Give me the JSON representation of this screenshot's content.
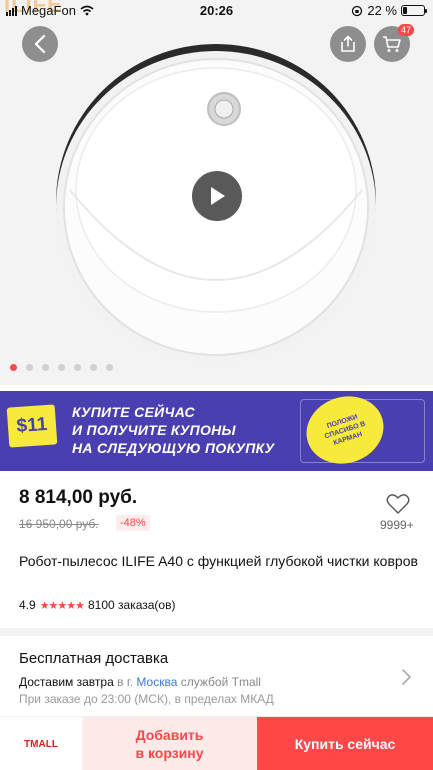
{
  "status_bar": {
    "brand_ghost": "ILIFE",
    "carrier": "MegaFon",
    "time": "20:26",
    "battery_text": "22 %",
    "battery_level": 0.22
  },
  "header": {
    "cart_badge": "47"
  },
  "gallery": {
    "dot_count": 7,
    "active_index": 0
  },
  "banner": {
    "coupon_value": "$11",
    "line1": "КУПИТЕ СЕЙЧАС",
    "line2": "И ПОЛУЧИТЕ КУПОНЫ",
    "line3": "НА СЛЕДУЮЩУЮ ПОКУПКУ",
    "sticker_text": "ПОЛОЖИ СПАСИБО В КАРМАН"
  },
  "product": {
    "price": "8 814,00 руб.",
    "old_price": "16 950,00 руб.",
    "discount": "-48%",
    "wishlist_count": "9999+",
    "title": "Робот-пылесос ILIFE A40 с функцией глубокой чистки ковров",
    "rating": "4.9",
    "stars": "★★★★★",
    "orders": "8100 заказа(ов)"
  },
  "shipping": {
    "title": "Бесплатная доставка",
    "deliver_prefix": "Доставим завтра",
    "in_city": "в г.",
    "city": "Москва",
    "service": "службой Tmall",
    "note": "При заказе до 23:00 (МСК), в пределах МКАД"
  },
  "bottom_bar": {
    "tmall_label": "TMALL",
    "add_to_cart_line1": "Добавить",
    "add_to_cart_line2": "в корзину",
    "buy_now": "Купить сейчас"
  },
  "colors": {
    "accent": "#ff4747",
    "banner_bg": "#4a3fb0",
    "banner_yellow": "#f7ea3b",
    "link": "#3b77d8"
  }
}
